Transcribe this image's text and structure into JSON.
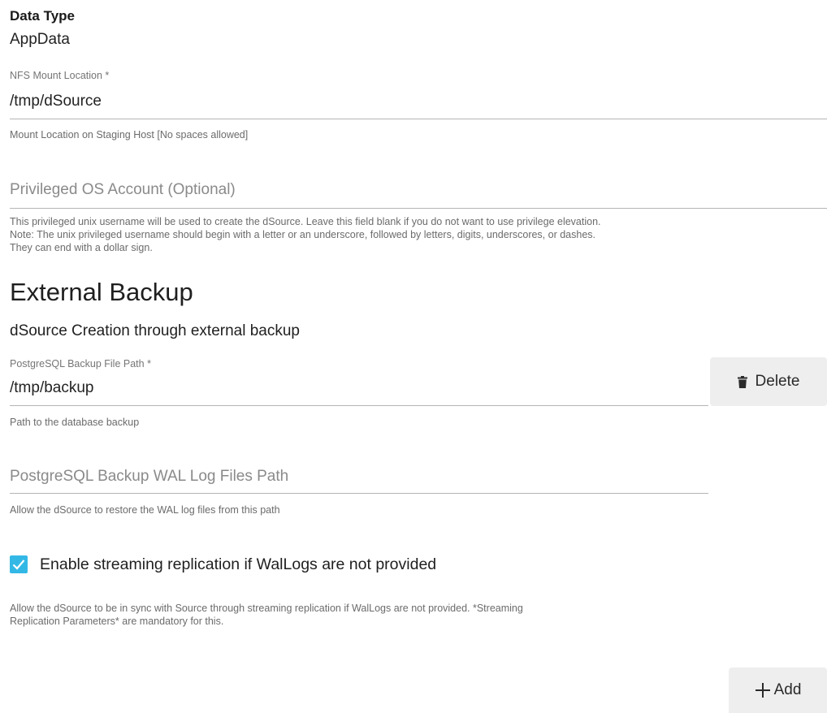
{
  "data_type": {
    "label": "Data Type",
    "value": "AppData"
  },
  "nfs_mount": {
    "label": "NFS Mount Location *",
    "value": "/tmp/dSource",
    "helper": "Mount Location on Staging Host [No spaces allowed]"
  },
  "privileged_account": {
    "placeholder": "Privileged OS Account (Optional)",
    "value": "",
    "helper_lines": [
      "This privileged unix username will be used to create the dSource. Leave this field blank if you do not want to use privilege elevation.",
      "Note: The unix privileged username should begin with a letter or an underscore, followed by letters, digits, underscores, or dashes.",
      "They can end with a dollar sign."
    ]
  },
  "external_backup": {
    "heading": "External Backup",
    "subheading": "dSource Creation through external backup",
    "backup_path": {
      "label": "PostgreSQL Backup File Path *",
      "value": "/tmp/backup",
      "helper": "Path to the database backup"
    },
    "delete_button": {
      "label": "Delete",
      "icon": "trash-icon"
    },
    "wal_path": {
      "placeholder": "PostgreSQL Backup WAL Log Files Path",
      "value": "",
      "helper": "Allow the dSource to restore the WAL log files from this path"
    },
    "streaming": {
      "checked": true,
      "label": "Enable streaming replication if WalLogs are not provided",
      "helper_lines": [
        "Allow the dSource to be in sync with Source through streaming replication if WalLogs are not provided. *Streaming",
        "Replication Parameters* are mandatory for this."
      ]
    }
  },
  "add_button": {
    "label": "Add",
    "icon": "plus-icon"
  },
  "colors": {
    "checkbox_accent": "#33b8e6",
    "button_bg": "#eeeeee",
    "underline": "#b5b5b5"
  }
}
